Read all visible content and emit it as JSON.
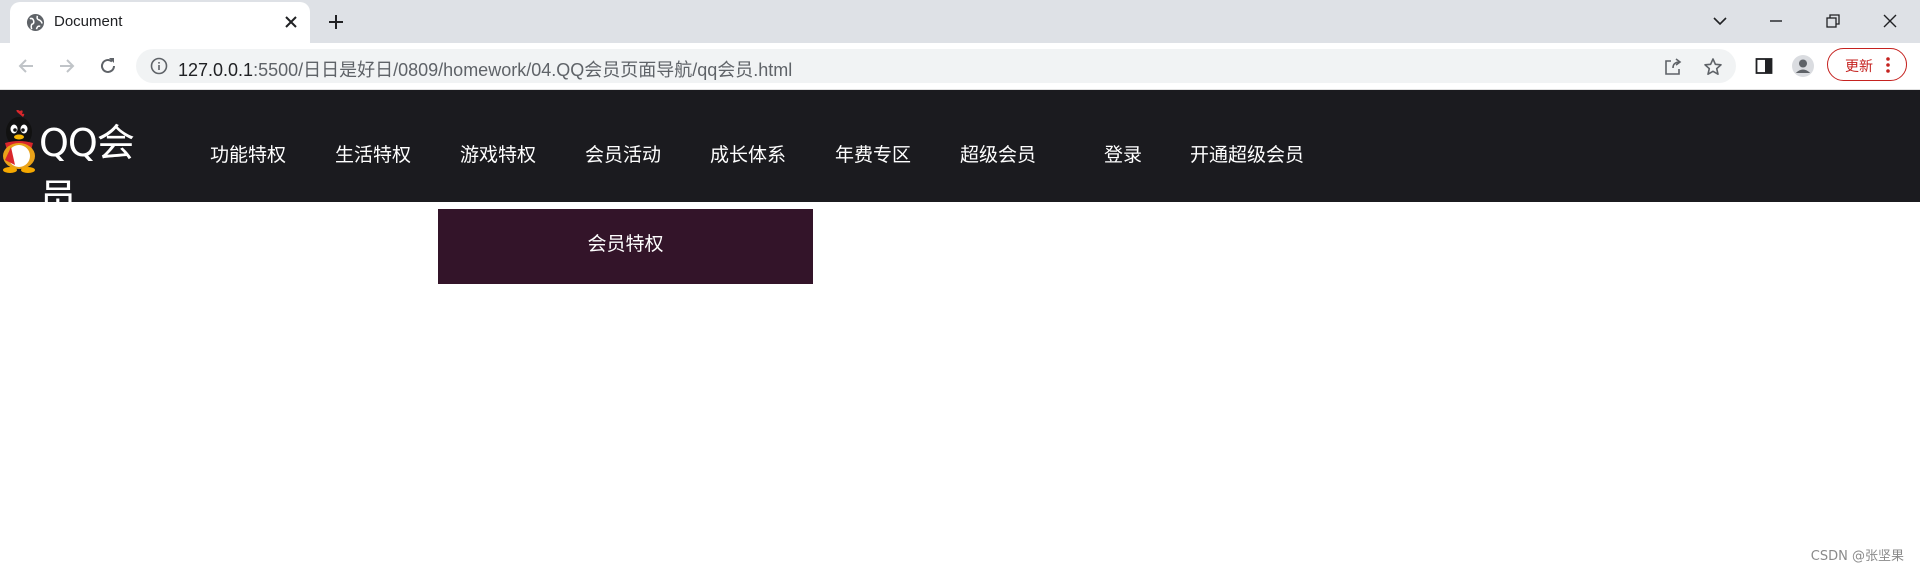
{
  "browser": {
    "tab_title": "Document",
    "url_host": "127.0.0.1",
    "url_path": ":5500/日日是好日/0809/homework/04.QQ会员页面导航/qq会员.html",
    "update_label": "更新",
    "update_color": "#c5221f"
  },
  "site": {
    "logo_text": "QQ会员",
    "nav_bg": "#1b1b1f",
    "nav_items": [
      "功能特权",
      "生活特权",
      "游戏特权",
      "会员活动",
      "成长体系",
      "年费专区",
      "超级会员",
      "登录",
      "开通超级会员"
    ],
    "dropdown_bg": "#331429",
    "dropdown_items": [
      "会员特权"
    ]
  },
  "watermark": "CSDN @张坚果"
}
